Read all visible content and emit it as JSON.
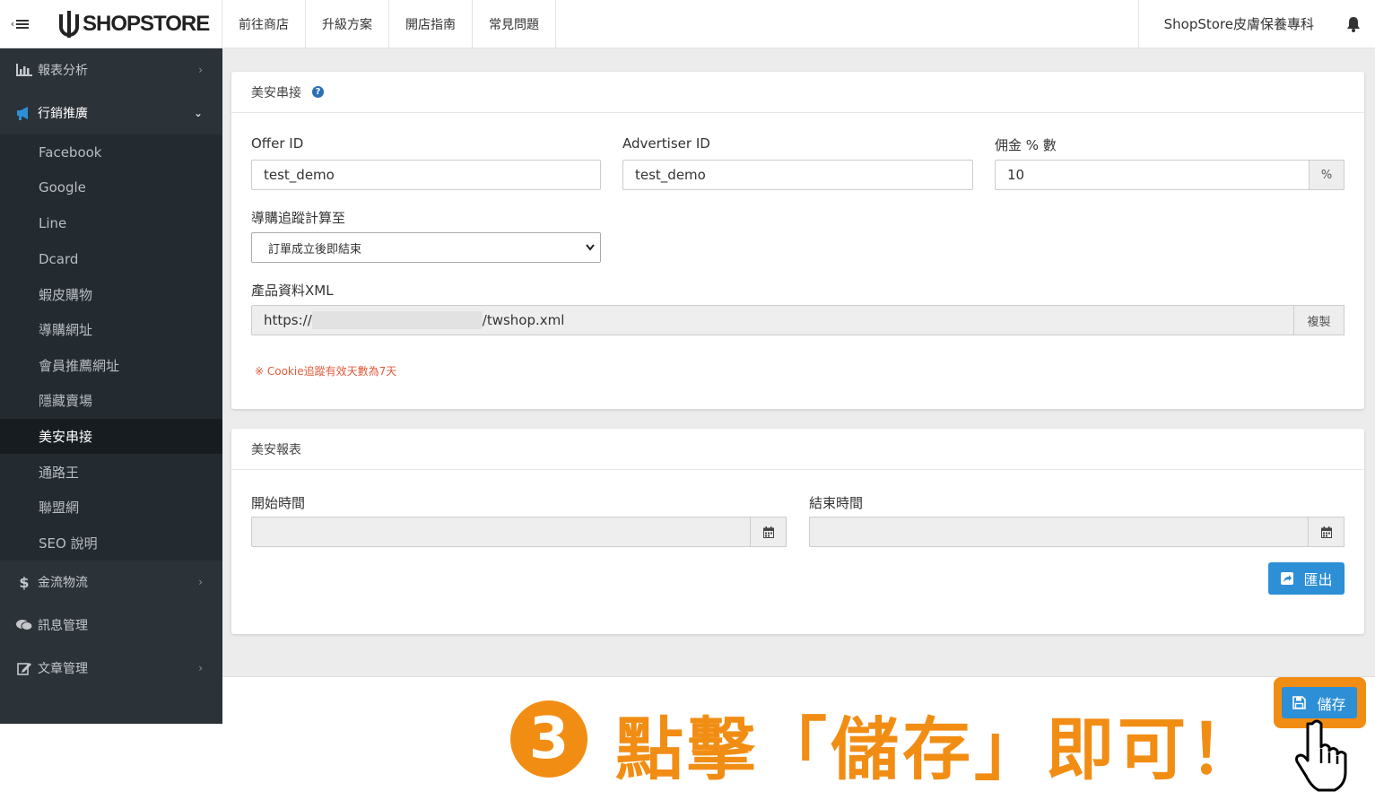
{
  "topbar": {
    "logo_text": "SHOPSTORE",
    "nav": [
      "前往商店",
      "升級方案",
      "開店指南",
      "常見問題"
    ],
    "store_name": "ShopStore皮膚保養專科"
  },
  "sidebar": {
    "items": [
      {
        "label": "報表分析",
        "icon": "bar-chart-icon"
      },
      {
        "label": "行銷推廣",
        "icon": "megaphone-icon"
      },
      {
        "label": "金流物流",
        "icon": "dollar-icon"
      },
      {
        "label": "訊息管理",
        "icon": "chat-icon"
      },
      {
        "label": "文章管理",
        "icon": "edit-icon"
      }
    ],
    "submenu": [
      "Facebook",
      "Google",
      "Line",
      "Dcard",
      "蝦皮購物",
      "導購網址",
      "會員推薦網址",
      "隱藏賣場",
      "美安串接",
      "通路王",
      "聯盟網",
      "SEO 說明"
    ],
    "current": "美安串接"
  },
  "panel1": {
    "title": "美安串接",
    "offer_label": "Offer ID",
    "offer_value": "test_demo",
    "advertiser_label": "Advertiser ID",
    "advertiser_value": "test_demo",
    "commission_label": "佣金 % 數",
    "commission_value": "10",
    "commission_unit": "%",
    "tracking_label": "導購追蹤計算至",
    "tracking_value": "訂單成立後即結束",
    "xml_label": "產品資料XML",
    "xml_prefix": "https://",
    "xml_suffix": "/twshop.xml",
    "copy_label": "複製",
    "note": "※ Cookie追蹤有效天數為7天"
  },
  "panel2": {
    "title": "美安報表",
    "start_label": "開始時間",
    "end_label": "結束時間",
    "export_label": "匯出"
  },
  "save_label": "儲存",
  "callout": {
    "step": "3",
    "text": "點擊「儲存」即可！"
  },
  "colors": {
    "accent": "#2d8fd5",
    "callout": "#f28d14",
    "sidebar": "#2b3238"
  }
}
